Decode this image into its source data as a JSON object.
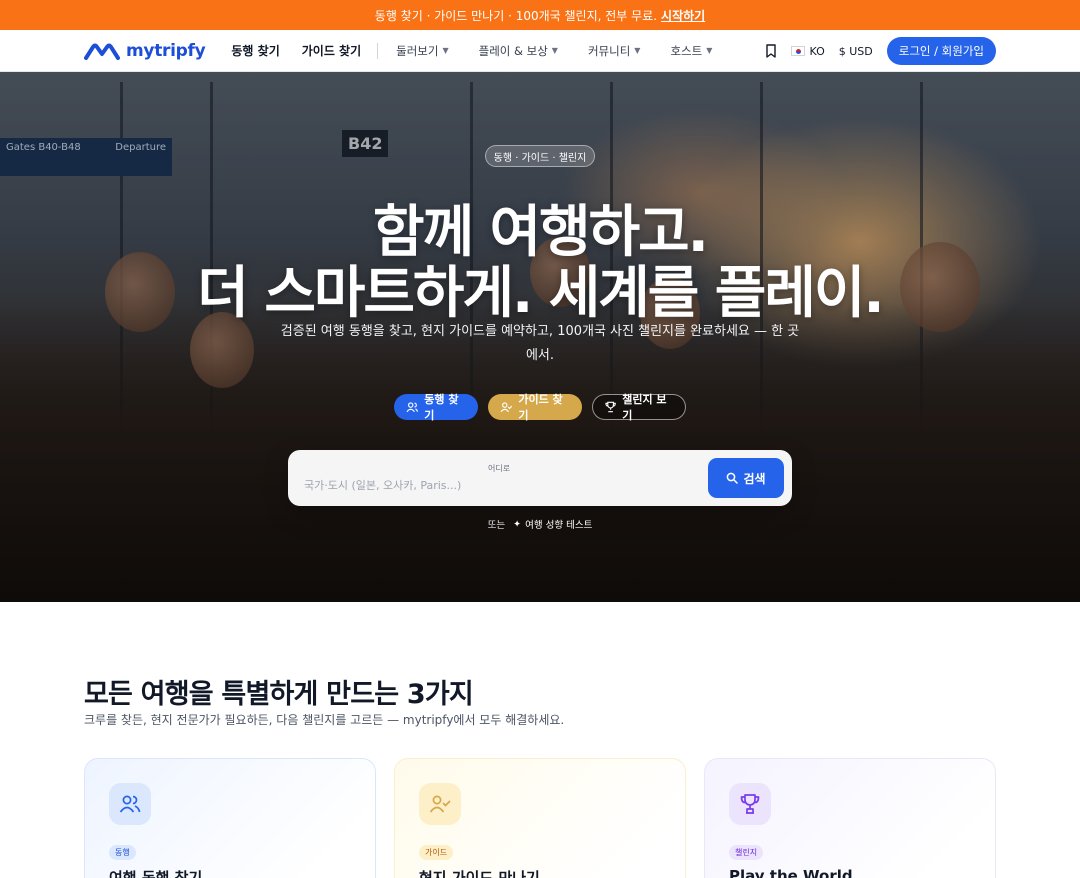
{
  "promo": {
    "text": "동행 찾기 · 가이드 만나기 · 100개국 챌린지, 전부 무료.",
    "link": "시작하기"
  },
  "nav": {
    "brand": "mytripfy",
    "primary": [
      "동행 찾기",
      "가이드 찾기"
    ],
    "menus": [
      "둘러보기",
      "플레이 & 보상",
      "커뮤니티",
      "호스트"
    ],
    "language": "KO",
    "currency": "$ USD",
    "login": "로그인 / 회원가입"
  },
  "hero": {
    "badge": "동행 · 가이드 · 챌린지",
    "title_line1": "함께 여행하고.",
    "title_line2": "더 스마트하게. 세계를 플레이.",
    "subtitle": "검증된 여행 동행을 찾고, 현지 가이드를 예약하고, 100개국 사진 챌린지를 완료하세요 — 한 곳에서.",
    "cta_companion": "동행 찾기",
    "cta_guide": "가이드 찾기",
    "cta_challenge": "챌린지 보기",
    "scene_text": {
      "gate_sign": "Gates B40-B48",
      "departure": "Departure",
      "gate_number": "B42"
    },
    "search": {
      "label": "어디로",
      "placeholder": "국가·도시 (일본, 오사카, Paris...)",
      "value": "",
      "button": "검색"
    },
    "or_text": "또는",
    "quiz_link": "여행 성향 테스트"
  },
  "features": {
    "title": "모든 여행을 특별하게 만드는 3가지",
    "subtitle": "크루를 찾든, 현지 전문가가 필요하든, 다음 챌린지를 고르든 — mytripfy에서 모두 해결하세요.",
    "cards": [
      {
        "tag": "동행",
        "title": "여행 동행 찾기",
        "icon": "users-icon"
      },
      {
        "tag": "가이드",
        "title": "현지 가이드 만나기",
        "icon": "user-check-icon"
      },
      {
        "tag": "챌린지",
        "title": "Play the World",
        "icon": "trophy-icon"
      }
    ]
  },
  "colors": {
    "promo": "#f97316",
    "primary": "#2563eb",
    "gold": "#d4a84b"
  }
}
